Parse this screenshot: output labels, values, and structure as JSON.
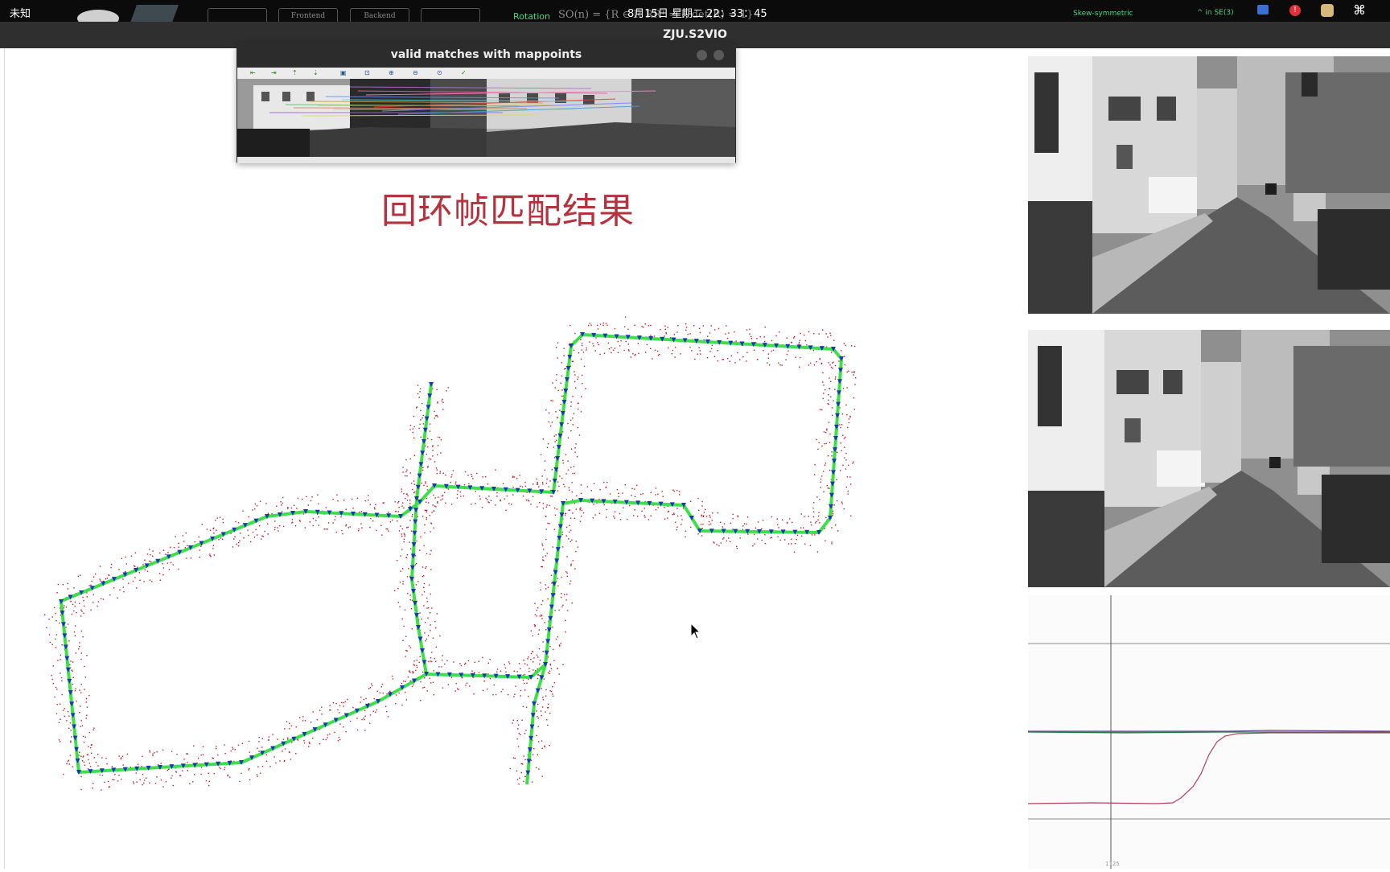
{
  "topbar": {
    "app_label": "未知",
    "tabs": [
      "",
      "Frontend",
      "Backend",
      ""
    ],
    "rotation_label": "Rotation",
    "math_text": "SO(n) = {R ∈ ℝ   RRᵀ = I, det(R) = 1}",
    "datetime": "8月15日 星期二 22：33：45",
    "skew_label": "Skew-symmetric",
    "se3_label": "^ in SE(3)",
    "icons": [
      "camera-icon",
      "alert-icon",
      "cat-icon",
      "command-icon"
    ]
  },
  "window": {
    "title": "ZJU.S2VIO"
  },
  "match_window": {
    "title": "valid matches with mappoints",
    "toolbar_icons": [
      "arrow-left-icon",
      "arrow-right-icon",
      "arrow-up-icon",
      "arrow-down-icon",
      "save-icon",
      "zoom-fit-icon",
      "zoom-in-icon",
      "zoom-out-icon",
      "zoom-reset-icon",
      "check-icon"
    ]
  },
  "overlay": {
    "title": "回环帧匹配结果",
    "color": "#b5323f"
  },
  "map": {
    "trajectory_color": "#3ee04a",
    "points_color": "#c0182a",
    "pose_marker_color": "#1a3ab0"
  },
  "plot": {
    "series": [
      {
        "color": "#1a7a3a"
      },
      {
        "color": "#b04060"
      },
      {
        "color": "#6a4a9a"
      }
    ],
    "x_tick": "1125"
  }
}
